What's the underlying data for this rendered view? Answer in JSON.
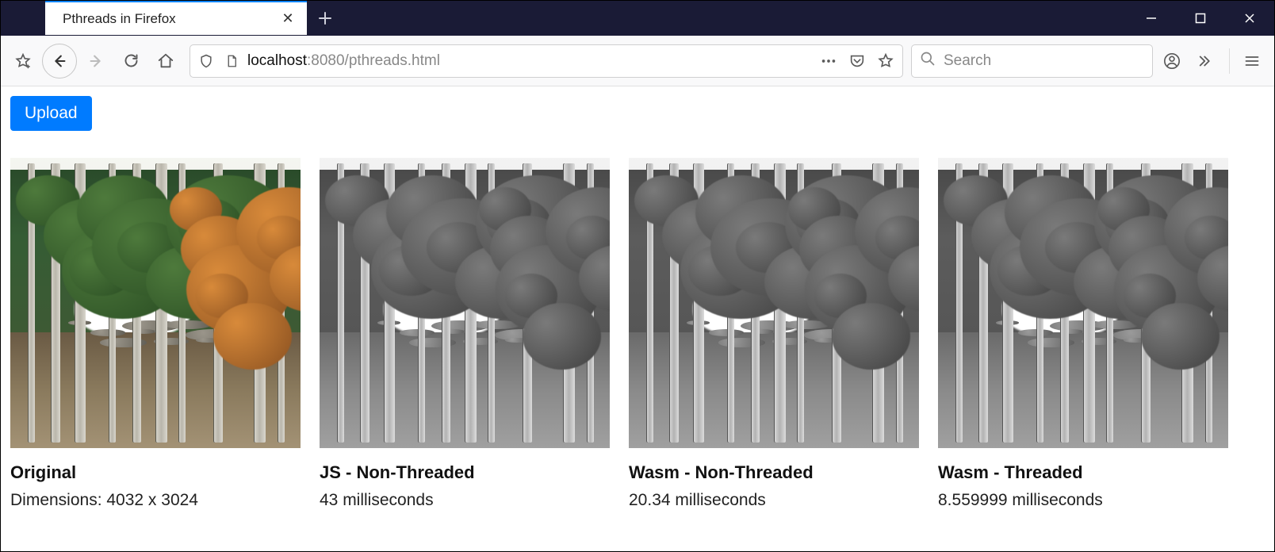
{
  "tab": {
    "title": "Pthreads in Firefox"
  },
  "url": {
    "host": "localhost",
    "port_path": ":8080/pthreads.html"
  },
  "search": {
    "placeholder": "Search"
  },
  "page": {
    "upload_label": "Upload",
    "cards": [
      {
        "title": "Original",
        "sub": "Dimensions: 4032 x 3024",
        "mode": "color"
      },
      {
        "title": "JS - Non-Threaded",
        "sub": "43 milliseconds",
        "mode": "gray"
      },
      {
        "title": "Wasm - Non-Threaded",
        "sub": "20.34 milliseconds",
        "mode": "gray"
      },
      {
        "title": "Wasm - Threaded",
        "sub": "8.559999 milliseconds",
        "mode": "gray"
      }
    ]
  }
}
